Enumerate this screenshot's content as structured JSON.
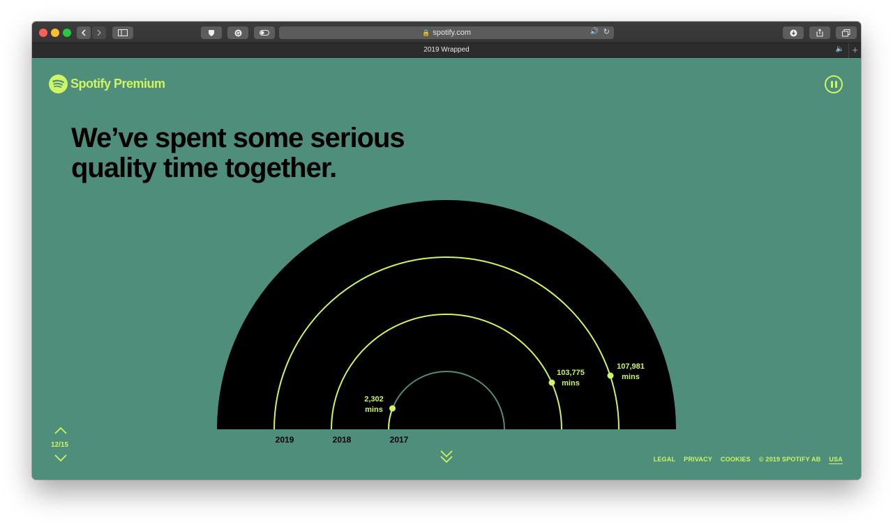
{
  "browser": {
    "address": "spotify.com",
    "tab_title": "2019 Wrapped"
  },
  "brand": {
    "logo_text": "Spotify Premium",
    "accent": "#cdf564",
    "background": "#4f8e7b"
  },
  "headline": {
    "line1": "We’ve spent some serious",
    "line2": "quality time together."
  },
  "chart_data": {
    "type": "arc",
    "categories": [
      "2019",
      "2018",
      "2017"
    ],
    "annotations": [
      {
        "year": "2017",
        "value": "2,302",
        "unit": "mins"
      },
      {
        "year": "2018",
        "value": "103,775",
        "unit": "mins"
      },
      {
        "year": "2019",
        "value": "107,981",
        "unit": "mins"
      }
    ]
  },
  "nav": {
    "counter": "12/15"
  },
  "footer": {
    "links": [
      "LEGAL",
      "PRIVACY",
      "COOKIES"
    ],
    "copyright": "© 2019 SPOTIFY AB",
    "region": "USA"
  }
}
